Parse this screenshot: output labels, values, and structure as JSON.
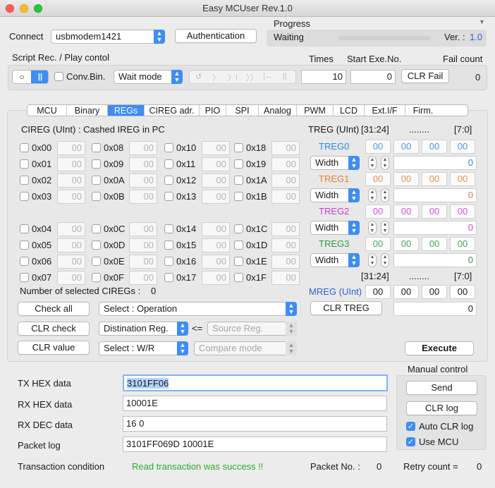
{
  "window": {
    "title": "Easy MCUser Rev.1.0"
  },
  "header": {
    "connect_label": "Connect",
    "port": "usbmodem1421",
    "auth_button": "Authentication",
    "progress_label": "Progress",
    "progress_status": "Waiting",
    "progress_value": 0,
    "version_label": "Ver. :",
    "version_value": "1.0"
  },
  "script": {
    "label": "Script Rec. / Play contol",
    "conv_bin": "Conv.Bin.",
    "mode": "Wait mode",
    "times_label": "Times",
    "times_value": "10",
    "start_label": "Start Exe.No.",
    "start_value": "0",
    "clr_fail": "CLR Fail",
    "fail_label": "Fail count",
    "fail_value": "0"
  },
  "tabs": [
    "MCU",
    "Binary",
    "REGs",
    "CIREG adr.",
    "PIO",
    "SPI",
    "Analog",
    "PWM",
    "LCD",
    "Ext.I/F",
    "Firm."
  ],
  "selected_tab": "REGs",
  "cireg": {
    "title": "CIREG (UInt) : Cashed IREG in PC",
    "col0": [
      "0x00",
      "0x01",
      "0x02",
      "0x03",
      "0x04",
      "0x05",
      "0x06",
      "0x07"
    ],
    "col1": [
      "0x08",
      "0x09",
      "0x0A",
      "0x0B",
      "0x0C",
      "0x0D",
      "0x0E",
      "0x0F"
    ],
    "col2": [
      "0x10",
      "0x11",
      "0x12",
      "0x13",
      "0x14",
      "0x15",
      "0x16",
      "0x17"
    ],
    "col3": [
      "0x18",
      "0x19",
      "0x1A",
      "0x1B",
      "0x1C",
      "0x1D",
      "0x1E",
      "0x1F"
    ],
    "value": "00",
    "selected_label": "Number of selected CIREGs :",
    "selected_count": "0",
    "check_all": "Check all",
    "clr_check": "CLR check",
    "clr_value": "CLR value",
    "operation": "Select : Operation",
    "dest_reg": "Distination Reg.",
    "arrow": "<=",
    "source_reg": "Source Reg.",
    "select_wr": "Select : W/R",
    "compare_mode": "Compare mode"
  },
  "treg": {
    "title": "TREG (UInt)",
    "range_hi": "[31:24]",
    "dots": "........",
    "range_lo": "[7:0]",
    "registers": [
      {
        "name": "TREG0",
        "color": "#2b8ad9",
        "bytes": [
          "00",
          "00",
          "00",
          "00"
        ],
        "width": "Width",
        "value": "0"
      },
      {
        "name": "TREG1",
        "color": "#e0823a",
        "bytes": [
          "00",
          "00",
          "00",
          "00"
        ],
        "width": "Width",
        "value": "0"
      },
      {
        "name": "TREG2",
        "color": "#d13ad9",
        "bytes": [
          "00",
          "00",
          "00",
          "00"
        ],
        "width": "Width",
        "value": "0"
      },
      {
        "name": "TREG3",
        "color": "#2e9b4e",
        "bytes": [
          "00",
          "00",
          "00",
          "00"
        ],
        "width": "Width",
        "value": "0"
      }
    ],
    "mreg_label": "MREG (UInt)",
    "mreg_color": "#2b62d9",
    "mreg_bytes": [
      "00",
      "00",
      "00",
      "00"
    ],
    "clr_treg": "CLR TREG",
    "mreg_value": "0",
    "execute": "Execute"
  },
  "comm": {
    "tx_label": "TX HEX data",
    "tx_value": "3101FF06",
    "rx_hex_label": "RX HEX data",
    "rx_hex_value": "10001E",
    "rx_dec_label": "RX DEC data",
    "rx_dec_value": "16 0",
    "log_label": "Packet log",
    "log_value": "3101FF069D 10001E"
  },
  "manual": {
    "title": "Manual control",
    "send": "Send",
    "clr_log": "CLR log",
    "auto_clr": "Auto CLR log",
    "use_mcu": "Use MCU"
  },
  "status": {
    "label": "Transaction condition",
    "message": "Read transaction was success !!",
    "message_color": "#2ea82e",
    "packet_label": "Packet No. :",
    "packet_value": "0",
    "retry_label": "Retry count =",
    "retry_value": "0"
  }
}
